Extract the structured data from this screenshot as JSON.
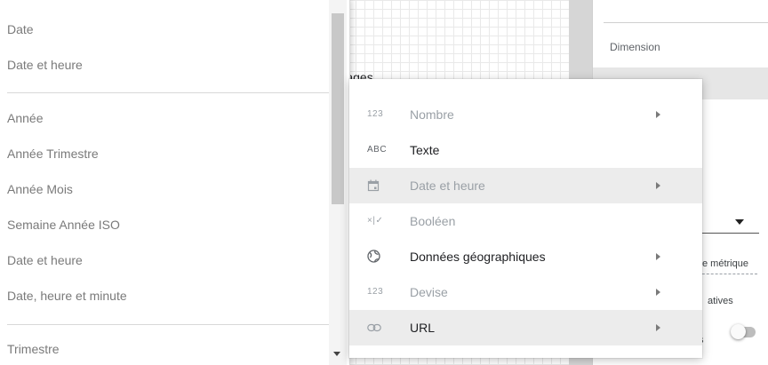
{
  "background": {
    "right_panel": {
      "dimension_label": "Dimension",
      "metric_snippet": "e métrique",
      "relatives_snippet": "atives",
      "s_snippet": "s",
      "toggle_state": "off"
    },
    "page_heading": "Pages"
  },
  "date_list": {
    "items": [
      {
        "label": "Date"
      },
      {
        "label": "Date et heure"
      },
      {
        "label": "Année"
      },
      {
        "label": "Année Trimestre"
      },
      {
        "label": "Année Mois"
      },
      {
        "label": "Semaine Année ISO"
      },
      {
        "label": "Date et heure"
      },
      {
        "label": "Date, heure et minute"
      },
      {
        "label": "Trimestre"
      }
    ]
  },
  "type_menu": {
    "items": [
      {
        "icon": "number-icon",
        "icon_text": "123",
        "label": "Nombre",
        "has_submenu": true,
        "disabled": true
      },
      {
        "icon": "text-icon",
        "icon_text": "ABC",
        "label": "Texte",
        "has_submenu": false,
        "disabled": false
      },
      {
        "icon": "calendar-icon",
        "icon_text": "",
        "label": "Date et heure",
        "has_submenu": true,
        "disabled": true,
        "highlighted": true
      },
      {
        "icon": "boolean-icon",
        "icon_text": "×|✓",
        "label": "Booléen",
        "has_submenu": false,
        "disabled": true
      },
      {
        "icon": "globe-icon",
        "icon_text": "",
        "label": "Données géographiques",
        "has_submenu": true,
        "disabled": false
      },
      {
        "icon": "currency-icon",
        "icon_text": "123",
        "label": "Devise",
        "has_submenu": true,
        "disabled": true
      },
      {
        "icon": "link-icon",
        "icon_text": "",
        "label": "URL",
        "has_submenu": true,
        "disabled": false,
        "highlighted": true
      }
    ]
  },
  "colors": {
    "highlight": "#ececec",
    "disabled_text": "#9aa0a6",
    "list_text": "#7a7a7a"
  }
}
